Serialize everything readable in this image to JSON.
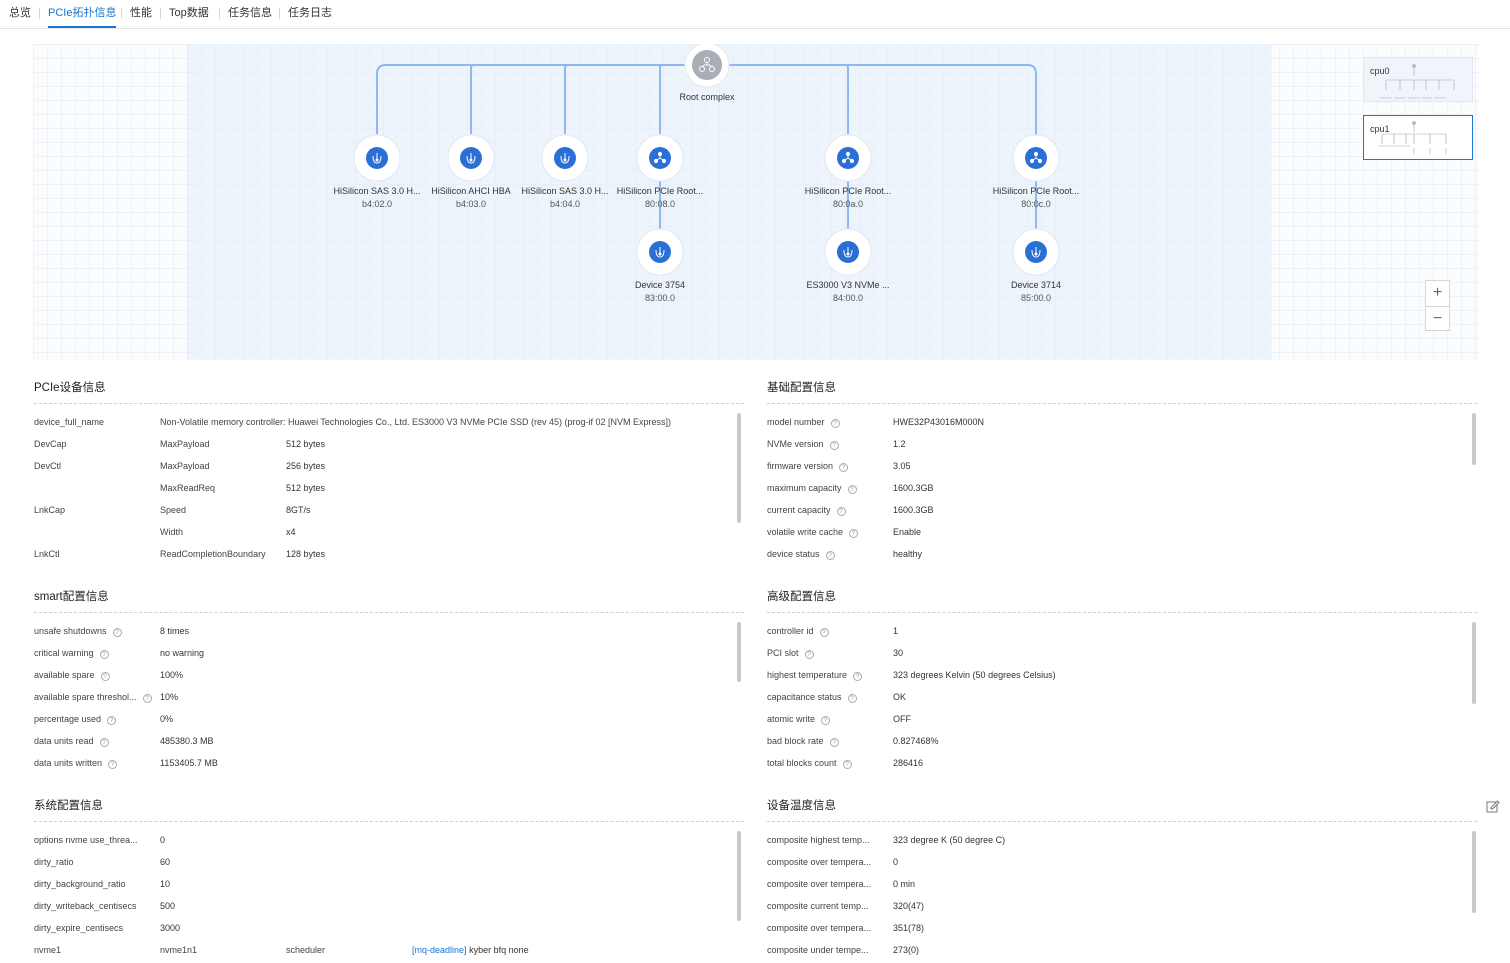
{
  "tabs": [
    {
      "label": "总览"
    },
    {
      "label": "PCIe拓扑信息"
    },
    {
      "label": "性能"
    },
    {
      "label": "Top数据"
    },
    {
      "label": "任务信息"
    },
    {
      "label": "任务日志"
    }
  ],
  "topology": {
    "root": {
      "label": "Root complex"
    },
    "level1": [
      {
        "name": "HiSilicon SAS 3.0 H...",
        "bdf": "b4:02.0",
        "icon": "usb-device-icon"
      },
      {
        "name": "HiSilicon AHCI HBA",
        "bdf": "b4:03.0",
        "icon": "usb-device-icon"
      },
      {
        "name": "HiSilicon SAS 3.0 H...",
        "bdf": "b4:04.0",
        "icon": "usb-device-icon"
      },
      {
        "name": "HiSilicon PCIe Root...",
        "bdf": "80:08.0",
        "icon": "bridge-icon"
      },
      {
        "name": "HiSilicon PCIe Root...",
        "bdf": "80:0a.0",
        "icon": "bridge-icon"
      },
      {
        "name": "HiSilicon PCIe Root...",
        "bdf": "80:0c.0",
        "icon": "bridge-icon"
      }
    ],
    "level2": [
      {
        "name": "Device 3754",
        "bdf": "83:00.0",
        "icon": "usb-device-icon"
      },
      {
        "name": "ES3000 V3 NVMe ...",
        "bdf": "84:00.0",
        "icon": "usb-device-icon"
      },
      {
        "name": "Device 3714",
        "bdf": "85:00.0",
        "icon": "usb-device-icon"
      }
    ],
    "minimaps": [
      {
        "label": "cpu0"
      },
      {
        "label": "cpu1"
      }
    ],
    "zoom": {
      "in": "+",
      "out": "−"
    }
  },
  "pcie_device": {
    "title": "PCIe设备信息",
    "rows": [
      {
        "k1": "device_full_name",
        "k2": "Non-Volatile memory controller: Huawei Technologies Co., Ltd. ES3000 V3 NVMe PCIe SSD (rev 45) (prog-if 02 [NVM Express])",
        "v": ""
      },
      {
        "k1": "DevCap",
        "k2": "MaxPayload",
        "v": "512 bytes"
      },
      {
        "k1": "DevCtl",
        "k2": "MaxPayload",
        "v": "256 bytes"
      },
      {
        "k1": "",
        "k2": "MaxReadReq",
        "v": "512 bytes"
      },
      {
        "k1": "LnkCap",
        "k2": "Speed",
        "v": "8GT/s"
      },
      {
        "k1": "",
        "k2": "Width",
        "v": "x4"
      },
      {
        "k1": "LnkCtl",
        "k2": "ReadCompletionBoundary",
        "v": "128 bytes"
      }
    ]
  },
  "basic_config": {
    "title": "基础配置信息",
    "rows": [
      {
        "k": "model number",
        "v": "HWE32P43016M000N"
      },
      {
        "k": "NVMe version",
        "v": "1.2"
      },
      {
        "k": "firmware version",
        "v": "3.05"
      },
      {
        "k": "maximum capacity",
        "v": "1600.3GB"
      },
      {
        "k": "current capacity",
        "v": "1600.3GB"
      },
      {
        "k": "volatile write cache",
        "v": "Enable"
      },
      {
        "k": "device status",
        "v": "healthy"
      }
    ]
  },
  "smart_config": {
    "title": "smart配置信息",
    "rows": [
      {
        "k": "unsafe shutdowns",
        "v": "8 times"
      },
      {
        "k": "critical warning",
        "v": "no warning"
      },
      {
        "k": "available spare",
        "v": "100%"
      },
      {
        "k": "available spare threshol...",
        "v": "10%"
      },
      {
        "k": "percentage used",
        "v": "0%"
      },
      {
        "k": "data units read",
        "v": "485380.3 MB"
      },
      {
        "k": "data units written",
        "v": "1153405.7 MB"
      }
    ]
  },
  "advanced_config": {
    "title": "高级配置信息",
    "rows": [
      {
        "k": "controller id",
        "v": "1"
      },
      {
        "k": "PCI slot",
        "v": "30"
      },
      {
        "k": "highest temperature",
        "v": "323 degrees Kelvin (50 degrees Celsius)"
      },
      {
        "k": "capacitance status",
        "v": "OK"
      },
      {
        "k": "atomic write",
        "v": "OFF"
      },
      {
        "k": "bad block rate",
        "v": "0.827468%"
      },
      {
        "k": "total blocks count",
        "v": "286416"
      }
    ]
  },
  "system_config": {
    "title": "系统配置信息",
    "rows": [
      {
        "k": "options nvme use_threa...",
        "v": "0"
      },
      {
        "k": "dirty_ratio",
        "v": "60"
      },
      {
        "k": "dirty_background_ratio",
        "v": "10"
      },
      {
        "k": "dirty_writeback_centisecs",
        "v": "500"
      },
      {
        "k": "dirty_expire_centisecs",
        "v": "3000"
      }
    ],
    "scheduler_row": {
      "k1": "nvme1",
      "k2": "nvme1n1",
      "k3": "scheduler",
      "active": "[mq-deadline]",
      "rest": "kyber bfq none"
    }
  },
  "temp_info": {
    "title": "设备温度信息",
    "rows": [
      {
        "k": "composite highest temp...",
        "v": "323 degree K (50 degree C)"
      },
      {
        "k": "composite over tempera...",
        "v": "0"
      },
      {
        "k": "composite over tempera...",
        "v": "0 min"
      },
      {
        "k": "composite current temp...",
        "v": "320(47)"
      },
      {
        "k": "composite over tempera...",
        "v": "351(78)"
      },
      {
        "k": "composite under tempe...",
        "v": "273(0)"
      }
    ]
  },
  "colors": {
    "accent": "#1976d2",
    "node_blue": "#2a6fd6",
    "root_gray": "#a9adb5",
    "edge": "#8fb8ee"
  }
}
